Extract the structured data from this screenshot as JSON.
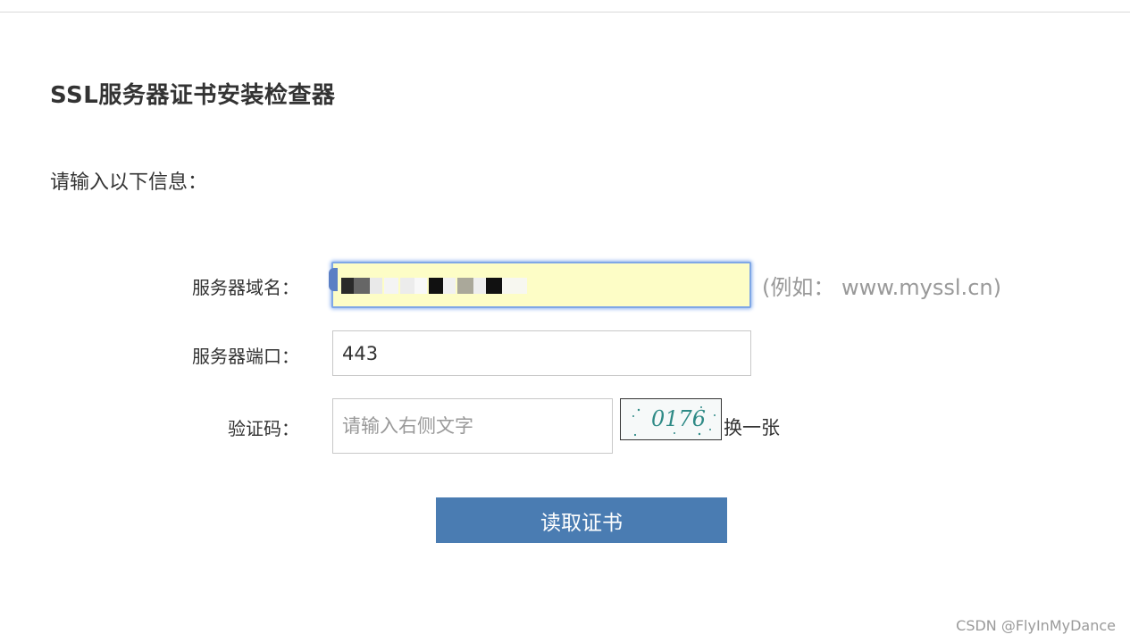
{
  "page": {
    "title": "SSL服务器证书安装检查器",
    "subtitle": "请输入以下信息："
  },
  "form": {
    "domain": {
      "label": "服务器域名：",
      "hint": "(例如： www.myssl.cn)"
    },
    "port": {
      "label": "服务器端口：",
      "value": "443"
    },
    "captcha": {
      "label": "验证码：",
      "placeholder": "请输入右侧文字",
      "image_text": "0176",
      "refresh_label": "换一张"
    },
    "submit_label": "读取证书"
  },
  "watermark": "CSDN @FlyInMyDance",
  "colors": {
    "accent": "#4a7cb2",
    "autofill_bg": "#fdfdc6",
    "focus_ring": "#7fa7e6",
    "captcha_text": "#2e8a86"
  }
}
